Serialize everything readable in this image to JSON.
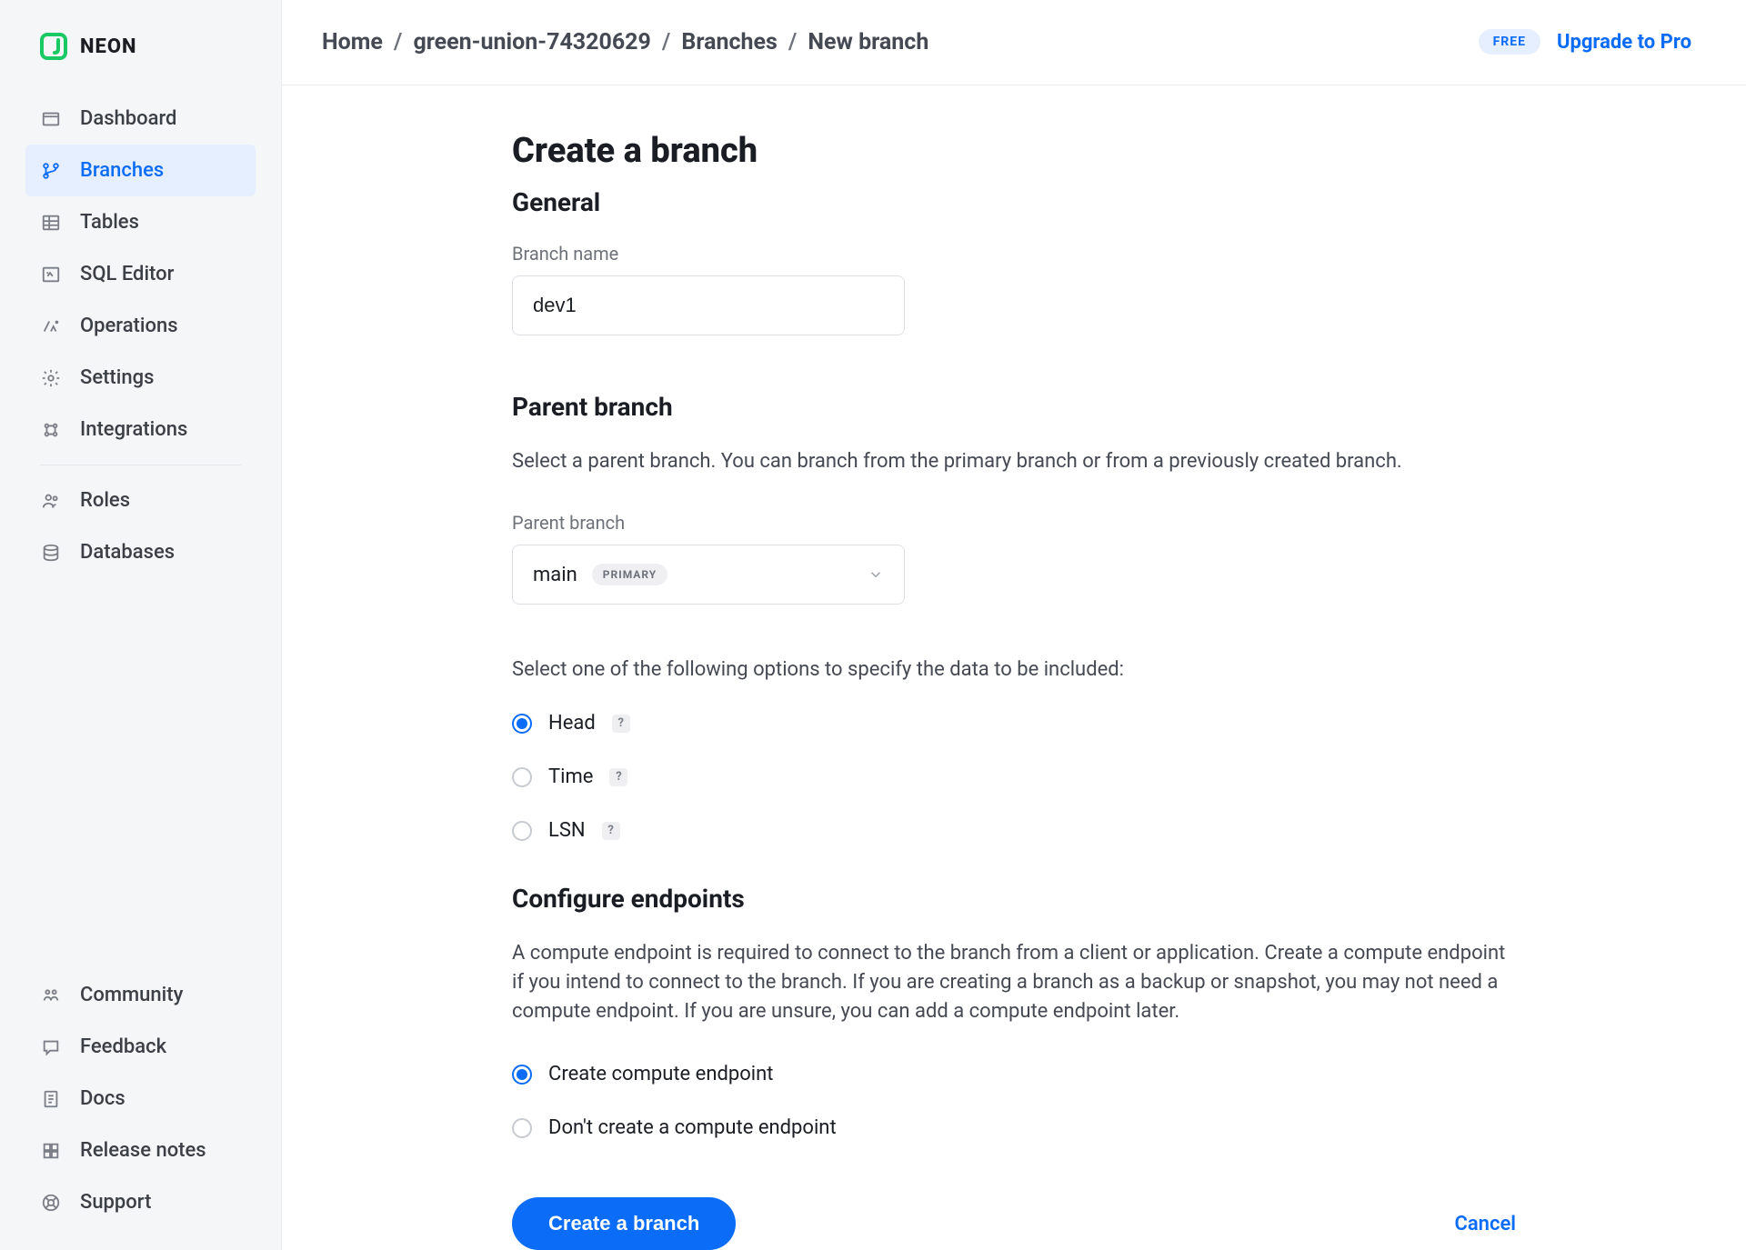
{
  "brand": {
    "name": "NEON"
  },
  "sidebar": {
    "items": [
      {
        "label": "Dashboard"
      },
      {
        "label": "Branches"
      },
      {
        "label": "Tables"
      },
      {
        "label": "SQL Editor"
      },
      {
        "label": "Operations"
      },
      {
        "label": "Settings"
      },
      {
        "label": "Integrations"
      },
      {
        "label": "Roles"
      },
      {
        "label": "Databases"
      }
    ],
    "bottom": [
      {
        "label": "Community"
      },
      {
        "label": "Feedback"
      },
      {
        "label": "Docs"
      },
      {
        "label": "Release notes"
      },
      {
        "label": "Support"
      }
    ]
  },
  "breadcrumb": {
    "home": "Home",
    "project": "green-union-74320629",
    "section": "Branches",
    "current": "New branch"
  },
  "tier": {
    "badge": "FREE",
    "upgrade": "Upgrade to Pro"
  },
  "form": {
    "page_title": "Create a branch",
    "general": {
      "title": "General",
      "branch_name_label": "Branch name",
      "branch_name_value": "dev1"
    },
    "parent": {
      "title": "Parent branch",
      "desc": "Select a parent branch. You can branch from the primary branch or from a previously created branch.",
      "select_label": "Parent branch",
      "selected_value": "main",
      "selected_pill": "PRIMARY",
      "data_prompt": "Select one of the following options to specify the data to be included:",
      "options": [
        {
          "label": "Head"
        },
        {
          "label": "Time"
        },
        {
          "label": "LSN"
        }
      ]
    },
    "endpoints": {
      "title": "Configure endpoints",
      "desc": "A compute endpoint is required to connect to the branch from a client or application. Create a compute endpoint if you intend to connect to the branch. If you are creating a branch as a backup or snapshot, you may not need a compute endpoint. If you are unsure, you can add a compute endpoint later.",
      "options": [
        {
          "label": "Create compute endpoint"
        },
        {
          "label": "Don't create a compute endpoint"
        }
      ]
    },
    "actions": {
      "submit": "Create a branch",
      "cancel": "Cancel"
    }
  }
}
